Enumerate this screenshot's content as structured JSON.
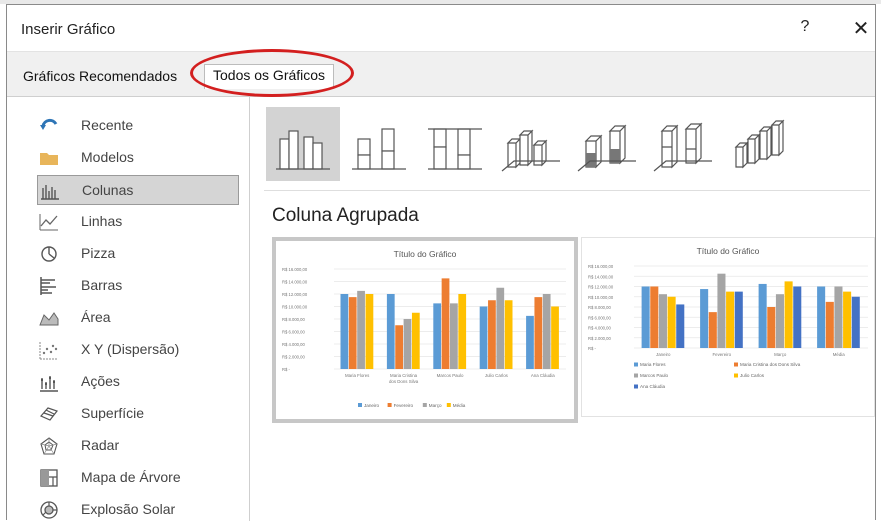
{
  "dialog": {
    "title": "Inserir Gráfico",
    "help": "?",
    "close": "✕"
  },
  "tabs": {
    "recommended": "Gráficos Recomendados",
    "all": "Todos os Gráficos"
  },
  "sidebar": {
    "items": [
      {
        "label": "Recente",
        "icon": "recent-icon"
      },
      {
        "label": "Modelos",
        "icon": "folder-icon"
      },
      {
        "label": "Colunas",
        "icon": "column-chart-icon",
        "selected": true
      },
      {
        "label": "Linhas",
        "icon": "line-chart-icon"
      },
      {
        "label": "Pizza",
        "icon": "pie-chart-icon"
      },
      {
        "label": "Barras",
        "icon": "bar-chart-icon"
      },
      {
        "label": "Área",
        "icon": "area-chart-icon"
      },
      {
        "label": "X Y (Dispersão)",
        "icon": "scatter-chart-icon"
      },
      {
        "label": "Ações",
        "icon": "stock-chart-icon"
      },
      {
        "label": "Superfície",
        "icon": "surface-chart-icon"
      },
      {
        "label": "Radar",
        "icon": "radar-chart-icon"
      },
      {
        "label": "Mapa de Árvore",
        "icon": "treemap-chart-icon"
      },
      {
        "label": "Explosão Solar",
        "icon": "sunburst-chart-icon"
      }
    ]
  },
  "subtypes": [
    "clustered-column-icon",
    "stacked-column-icon",
    "100-stacked-column-icon",
    "3d-clustered-column-icon",
    "3d-stacked-column-icon",
    "3d-100-stacked-column-icon",
    "3d-column-icon"
  ],
  "selected_subtype_label": "Coluna Agrupada",
  "colors": {
    "blue": "#5b9bd5",
    "orange": "#ed7d31",
    "gray": "#a5a5a5",
    "yellow": "#ffc000",
    "dark_blue": "#4472c4",
    "red_highlight": "#d31f1f"
  },
  "chart_data": [
    {
      "type": "bar",
      "title": "Título do Gráfico",
      "yticks": [
        "R$ 16.000,00",
        "R$ 14.000,00",
        "R$ 12.000,00",
        "R$ 10.000,00",
        "R$ 8.000,00",
        "R$ 6.000,00",
        "R$ 4.000,00",
        "R$ 2.000,00",
        "R$ -"
      ],
      "ylim": [
        0,
        16000
      ],
      "categories": [
        "Maria Flores",
        "Maria Cristina dos Dons Silva",
        "Marcos Paulo",
        "Julio Carlos",
        "Ana Cláudia"
      ],
      "series": [
        {
          "name": "Janeiro",
          "values": [
            12000,
            12000,
            10500,
            10000,
            8500
          ]
        },
        {
          "name": "Fevereiro",
          "values": [
            11500,
            7000,
            14500,
            11000,
            11500
          ]
        },
        {
          "name": "Março",
          "values": [
            12500,
            8000,
            10500,
            13000,
            12000
          ]
        },
        {
          "name": "Média",
          "values": [
            12000,
            9000,
            12000,
            11000,
            10000
          ]
        }
      ],
      "legend": "bottom",
      "grid": true
    },
    {
      "type": "bar",
      "title": "Título do Gráfico",
      "yticks": [
        "R$ 16.000,00",
        "R$ 14.000,00",
        "R$ 12.000,00",
        "R$ 10.000,00",
        "R$ 8.000,00",
        "R$ 6.000,00",
        "R$ 4.000,00",
        "R$ 2.000,00",
        "R$ -"
      ],
      "ylim": [
        0,
        16000
      ],
      "categories": [
        "Janeiro",
        "Fevereiro",
        "Março",
        "Média"
      ],
      "series": [
        {
          "name": "Maria Flores",
          "values": [
            12000,
            11500,
            12500,
            12000
          ]
        },
        {
          "name": "Maria Cristina dos Dons Silva",
          "values": [
            12000,
            7000,
            8000,
            9000
          ]
        },
        {
          "name": "Marcos Paulo",
          "values": [
            10500,
            14500,
            10500,
            12000
          ]
        },
        {
          "name": "Julio Carlos",
          "values": [
            10000,
            11000,
            13000,
            11000
          ]
        },
        {
          "name": "Ana Cláudia",
          "values": [
            8500,
            11000,
            12000,
            10000
          ]
        }
      ],
      "legend": "bottom",
      "grid": true
    }
  ]
}
